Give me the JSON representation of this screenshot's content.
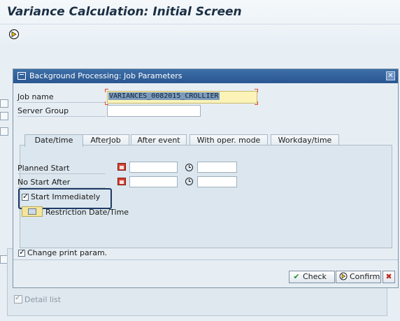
{
  "background": {
    "title": "Variance Calculation: Initial Screen",
    "detail_list_label": "Detail list"
  },
  "dialog": {
    "title": "Background Processing: Job Parameters",
    "job_name_label": "Job name",
    "job_name_value": "VARIANCES_0082015_CROLLIER",
    "server_group_label": "Server Group",
    "server_group_value": "",
    "tabs": [
      {
        "label": "Date/time",
        "active": true
      },
      {
        "label": "AfterJob",
        "active": false
      },
      {
        "label": "After event",
        "active": false
      },
      {
        "label": "With oper. mode",
        "active": false
      },
      {
        "label": "Workday/time",
        "active": false
      }
    ],
    "planned_start_label": "Planned Start",
    "no_start_after_label": "No Start After",
    "start_immediately_label": "Start Immediately",
    "start_immediately_checked": true,
    "restriction_label": "Restriction Date/Time",
    "change_print_label": "Change print param.",
    "change_print_checked": true,
    "buttons": {
      "check": "Check",
      "confirm": "Confirm"
    }
  },
  "colors": {
    "titlebar": "#2f5f99",
    "highlight_border": "#1f3a66",
    "job_name_bg": "#fbf3b8"
  }
}
